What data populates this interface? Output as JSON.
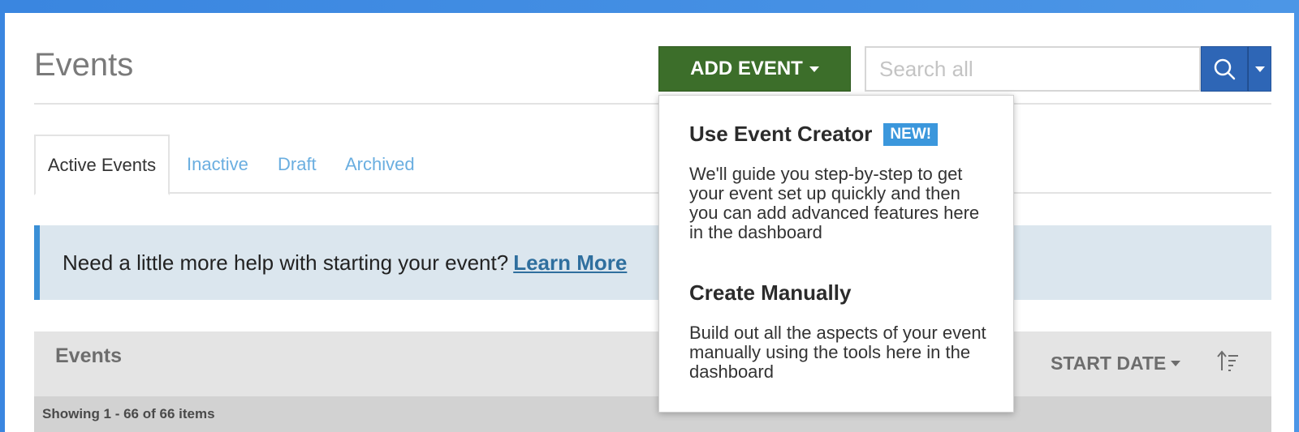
{
  "page": {
    "title": "Events"
  },
  "toolbar": {
    "add_event_label": "ADD EVENT"
  },
  "search": {
    "placeholder": "Search all"
  },
  "tabs": [
    {
      "label": "Active Events",
      "active": true
    },
    {
      "label": "Inactive",
      "active": false
    },
    {
      "label": "Draft",
      "active": false
    },
    {
      "label": "Archived",
      "active": false
    }
  ],
  "banner": {
    "text": "Need a little more help with starting your event?",
    "link": "Learn More"
  },
  "events_panel": {
    "title": "Events",
    "sort_label": "START DATE",
    "showing": "Showing 1 - 66 of 66 items"
  },
  "dropdown": {
    "items": [
      {
        "heading": "Use Event Creator",
        "badge": "NEW!",
        "description": "We'll guide you step-by-step to get your event set up quickly and then you can add advanced features here in the dashboard"
      },
      {
        "heading": "Create Manually",
        "description": "Build out all the aspects of your event manually using the tools here in the dashboard"
      }
    ]
  },
  "colors": {
    "add_button": "#3c6e2a",
    "search_button": "#2e66b6",
    "link": "#6aaee0",
    "badge": "#3b97dc",
    "banner_accent": "#3a8fd6"
  },
  "icons": {
    "search": "search-icon",
    "caret": "caret-down-icon",
    "sort_order": "sort-ascending-icon"
  }
}
